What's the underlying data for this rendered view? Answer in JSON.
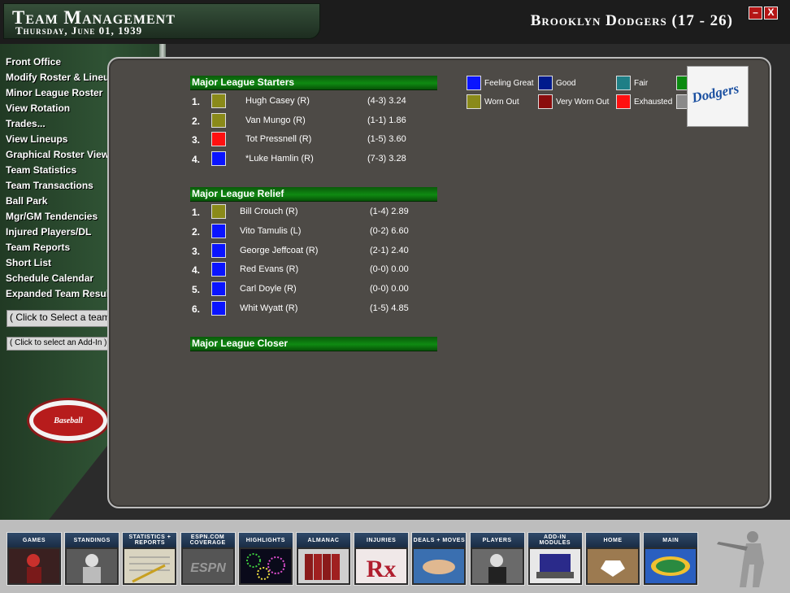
{
  "header": {
    "title": "Team Management",
    "date": "Thursday, June 01, 1939",
    "team_label": "Brooklyn Dodgers (17 - 26)",
    "minimize": "–",
    "close": "X"
  },
  "sidebar": {
    "items": [
      "Front Office",
      "Modify Roster & Lineups",
      "Minor League Roster",
      "View Rotation",
      "Trades...",
      "View Lineups",
      "Graphical Roster View",
      "Team Statistics",
      "Team Transactions",
      "Ball Park",
      "Mgr/GM Tendencies",
      "Injured Players/DL",
      "Team Reports",
      "Short List",
      "Schedule Calendar",
      "Expanded Team Results"
    ],
    "team_select": "( Click to Select a team )",
    "addin_select": "( Click to select an Add-In )",
    "logo_text": "Baseball"
  },
  "colors": {
    "feeling_great": "#0a14ff",
    "good": "#001a8c",
    "fair": "#1f7f86",
    "extra_green": "#0b8a10",
    "worn_out": "#8a8a1a",
    "very_worn_out": "#8a0d0d",
    "exhausted": "#ff1010",
    "grey": "#8a8a8a"
  },
  "legend": [
    {
      "label": "Feeling Great",
      "color": "feeling_great"
    },
    {
      "label": "Good",
      "color": "good"
    },
    {
      "label": "Fair",
      "color": "fair"
    },
    {
      "label": "Worn Out",
      "color": "worn_out"
    },
    {
      "label": "Very Worn Out",
      "color": "very_worn_out"
    },
    {
      "label": "Exhausted",
      "color": "exhausted"
    }
  ],
  "jersey_text": "Dodgers",
  "starters": {
    "header": "Major League Starters",
    "players": [
      {
        "num": "1.",
        "name": "Hugh Casey (R)",
        "stat": "(4-3) 3.24",
        "color": "worn_out"
      },
      {
        "num": "2.",
        "name": "Van Mungo (R)",
        "stat": "(1-1) 1.86",
        "color": "worn_out"
      },
      {
        "num": "3.",
        "name": "Tot Pressnell (R)",
        "stat": "(1-5) 3.60",
        "color": "exhausted"
      },
      {
        "num": "4.",
        "name": "*Luke Hamlin (R)",
        "stat": "(7-3) 3.28",
        "color": "feeling_great"
      }
    ]
  },
  "relief": {
    "header": "Major League Relief",
    "players": [
      {
        "num": "1.",
        "name": "Bill Crouch (R)",
        "stat": "(1-4) 2.89",
        "color": "worn_out"
      },
      {
        "num": "2.",
        "name": "Vito Tamulis (L)",
        "stat": "(0-2) 6.60",
        "color": "feeling_great"
      },
      {
        "num": "3.",
        "name": "George Jeffcoat (R)",
        "stat": "(2-1) 2.40",
        "color": "feeling_great"
      },
      {
        "num": "4.",
        "name": "Red Evans (R)",
        "stat": "(0-0) 0.00",
        "color": "feeling_great"
      },
      {
        "num": "5.",
        "name": "Carl Doyle (R)",
        "stat": "(0-0) 0.00",
        "color": "feeling_great"
      },
      {
        "num": "6.",
        "name": "Whit Wyatt (R)",
        "stat": "(1-5) 4.85",
        "color": "feeling_great"
      }
    ]
  },
  "closer": {
    "header": "Major League Closer"
  },
  "bottom_bar": [
    {
      "label": "GAMES",
      "icon": "batter-icon"
    },
    {
      "label": "STANDINGS",
      "icon": "manager-icon"
    },
    {
      "label": "STATISTICS + REPORTS",
      "icon": "stats-sheet-icon"
    },
    {
      "label": "ESPN.COM COVERAGE",
      "icon": "espn-icon"
    },
    {
      "label": "HIGHLIGHTS",
      "icon": "fireworks-icon"
    },
    {
      "label": "ALMANAC",
      "icon": "books-icon"
    },
    {
      "label": "INJURIES",
      "icon": "rx-icon"
    },
    {
      "label": "DEALS + MOVES",
      "icon": "handshake-icon"
    },
    {
      "label": "PLAYERS",
      "icon": "player-icon"
    },
    {
      "label": "ADD-IN MODULES",
      "icon": "laptop-icon"
    },
    {
      "label": "HOME",
      "icon": "home-plate-icon"
    },
    {
      "label": "MAIN",
      "icon": "main-logo-icon"
    }
  ]
}
